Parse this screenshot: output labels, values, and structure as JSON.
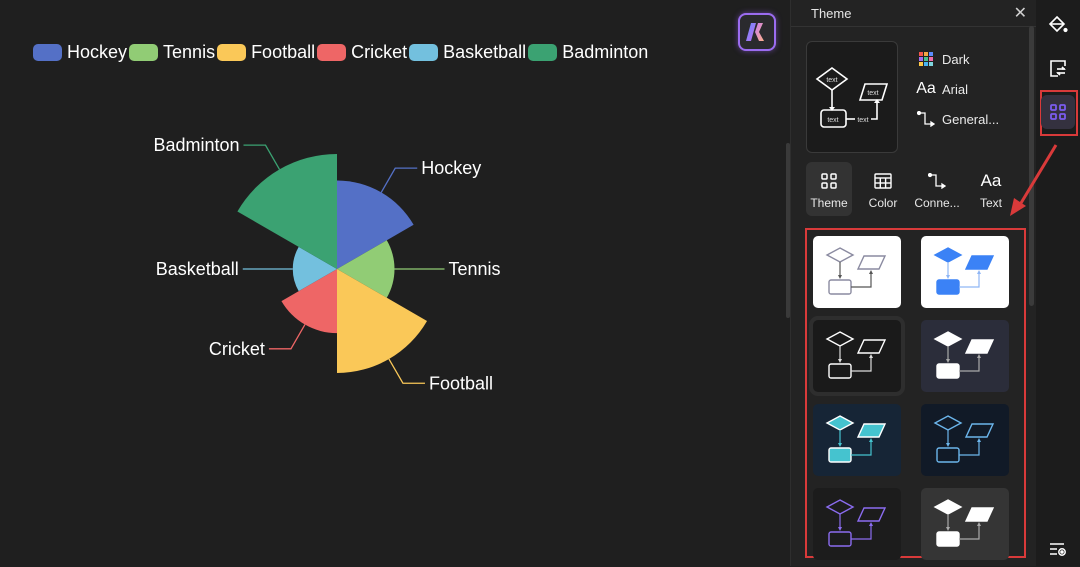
{
  "chart_data": {
    "type": "pie",
    "subtype": "rose",
    "title": "",
    "categories": [
      "Hockey",
      "Tennis",
      "Football",
      "Cricket",
      "Basketball",
      "Badminton"
    ],
    "values": [
      40,
      26,
      47,
      29,
      20,
      52
    ],
    "colors": [
      "#5470c6",
      "#91cc75",
      "#fac858",
      "#ee6666",
      "#73c0de",
      "#3ba272"
    ],
    "legend": {
      "position": "top-left",
      "entries": [
        "Hockey",
        "Tennis",
        "Football",
        "Cricket",
        "Basketball",
        "Badminton"
      ]
    },
    "labels": [
      "Hockey",
      "Tennis",
      "Football",
      "Cricket",
      "Basketball",
      "Badminton"
    ]
  },
  "panel": {
    "title": "Theme",
    "close_icon": "close-icon",
    "current": {
      "color_scheme": "Dark",
      "font": "Arial",
      "connector": "General...",
      "preview_text": "text"
    },
    "tabs": [
      {
        "label": "Theme",
        "icon": "theme-grid-icon",
        "active": true
      },
      {
        "label": "Color",
        "icon": "color-palette-icon",
        "active": false
      },
      {
        "label": "Conne...",
        "icon": "connector-icon",
        "active": false
      },
      {
        "label": "Text",
        "icon": "text-aa-icon",
        "active": false
      }
    ],
    "themes": [
      {
        "name": "light-outline",
        "bg": "#ffffff",
        "stroke": "#8a8aa0",
        "fill": "none",
        "line": "#555"
      },
      {
        "name": "light-blue",
        "bg": "#ffffff",
        "stroke": "#3b82f6",
        "fill": "#3b82f6",
        "line": "#8fb6f5"
      },
      {
        "name": "dark-outline",
        "bg": "#1a1a1a",
        "stroke": "#ffffff",
        "fill": "none",
        "line": "#ddd",
        "selected": true
      },
      {
        "name": "slate-white",
        "bg": "#2b2d3a",
        "stroke": "#ffffff",
        "fill": "#ffffff",
        "line": "#aaa"
      },
      {
        "name": "navy-teal",
        "bg": "#162536",
        "stroke": "#ffffff",
        "fill": "#45c3cf",
        "line": "#45c3cf"
      },
      {
        "name": "navy-sky",
        "bg": "#111a27",
        "stroke": "#6cb6ec",
        "fill": "none",
        "line": "#6cb6ec"
      },
      {
        "name": "dark-purple",
        "bg": "#1c1c1c",
        "stroke": "#8b6cf0",
        "fill": "none",
        "line": "#8b6cf0"
      },
      {
        "name": "gray-white",
        "bg": "#353535",
        "stroke": "#ffffff",
        "fill": "#ffffff",
        "line": "#aaa"
      }
    ]
  },
  "rail": {
    "items": [
      {
        "icon": "paint-bucket-icon",
        "active": false
      },
      {
        "icon": "page-settings-icon",
        "active": false
      },
      {
        "icon": "theme-grid-icon",
        "active": true
      },
      {
        "icon": "list-settings-icon",
        "active": false
      }
    ]
  },
  "colors": {
    "accent": "#7b5cf0",
    "highlight": "#d93a3a",
    "background": "#1f1f1f"
  }
}
